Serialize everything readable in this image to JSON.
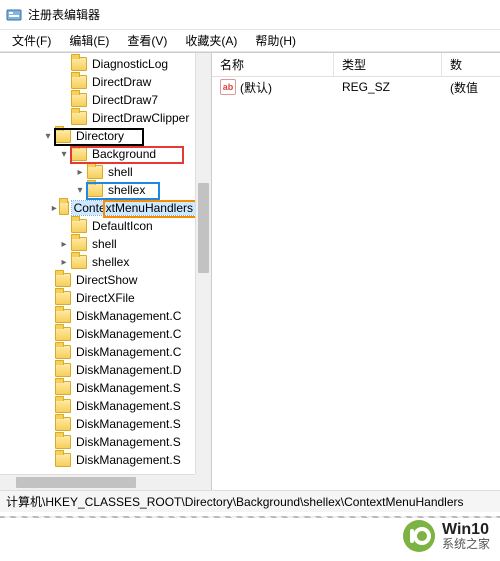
{
  "window": {
    "title": "注册表编辑器"
  },
  "menubar": {
    "items": [
      "文件(F)",
      "编辑(E)",
      "查看(V)",
      "收藏夹(A)",
      "帮助(H)"
    ]
  },
  "tree": {
    "nodes": [
      {
        "indent": 58,
        "expander": "",
        "label": "DiagnosticLog"
      },
      {
        "indent": 58,
        "expander": "",
        "label": "DirectDraw"
      },
      {
        "indent": 58,
        "expander": "",
        "label": "DirectDraw7"
      },
      {
        "indent": 58,
        "expander": "",
        "label": "DirectDrawClipper"
      },
      {
        "indent": 42,
        "expander": "▾",
        "label": "Directory",
        "hl": "black"
      },
      {
        "indent": 58,
        "expander": "▾",
        "label": "Background",
        "hl": "red"
      },
      {
        "indent": 74,
        "expander": "▸",
        "label": "shell"
      },
      {
        "indent": 74,
        "expander": "▾",
        "label": "shellex",
        "hl": "blue"
      },
      {
        "indent": 90,
        "expander": "▸",
        "label": "ContextMenuHandlers",
        "hl": "orange",
        "selected": true
      },
      {
        "indent": 58,
        "expander": "",
        "label": "DefaultIcon"
      },
      {
        "indent": 58,
        "expander": "▸",
        "label": "shell"
      },
      {
        "indent": 58,
        "expander": "▸",
        "label": "shellex"
      },
      {
        "indent": 42,
        "expander": "",
        "label": "DirectShow"
      },
      {
        "indent": 42,
        "expander": "",
        "label": "DirectXFile"
      },
      {
        "indent": 42,
        "expander": "",
        "label": "DiskManagement.C"
      },
      {
        "indent": 42,
        "expander": "",
        "label": "DiskManagement.C"
      },
      {
        "indent": 42,
        "expander": "",
        "label": "DiskManagement.C"
      },
      {
        "indent": 42,
        "expander": "",
        "label": "DiskManagement.D"
      },
      {
        "indent": 42,
        "expander": "",
        "label": "DiskManagement.S"
      },
      {
        "indent": 42,
        "expander": "",
        "label": "DiskManagement.S"
      },
      {
        "indent": 42,
        "expander": "",
        "label": "DiskManagement.S"
      },
      {
        "indent": 42,
        "expander": "",
        "label": "DiskManagement.S"
      },
      {
        "indent": 42,
        "expander": "",
        "label": "DiskManagement.S"
      }
    ]
  },
  "list": {
    "columns": {
      "name": "名称",
      "type": "类型",
      "data": "数"
    },
    "rows": [
      {
        "icon": "ab",
        "name": "(默认)",
        "type": "REG_SZ",
        "data": "(数值"
      }
    ]
  },
  "statusbar": {
    "path": "计算机\\HKEY_CLASSES_ROOT\\Directory\\Background\\shellex\\ContextMenuHandlers"
  },
  "watermark": {
    "line1": "Win10",
    "line2": "系统之家"
  },
  "colors": {
    "folder_fill_top": "#ffe9a6",
    "folder_fill_bottom": "#f7cf5b",
    "logo_green": "#7cb342"
  }
}
